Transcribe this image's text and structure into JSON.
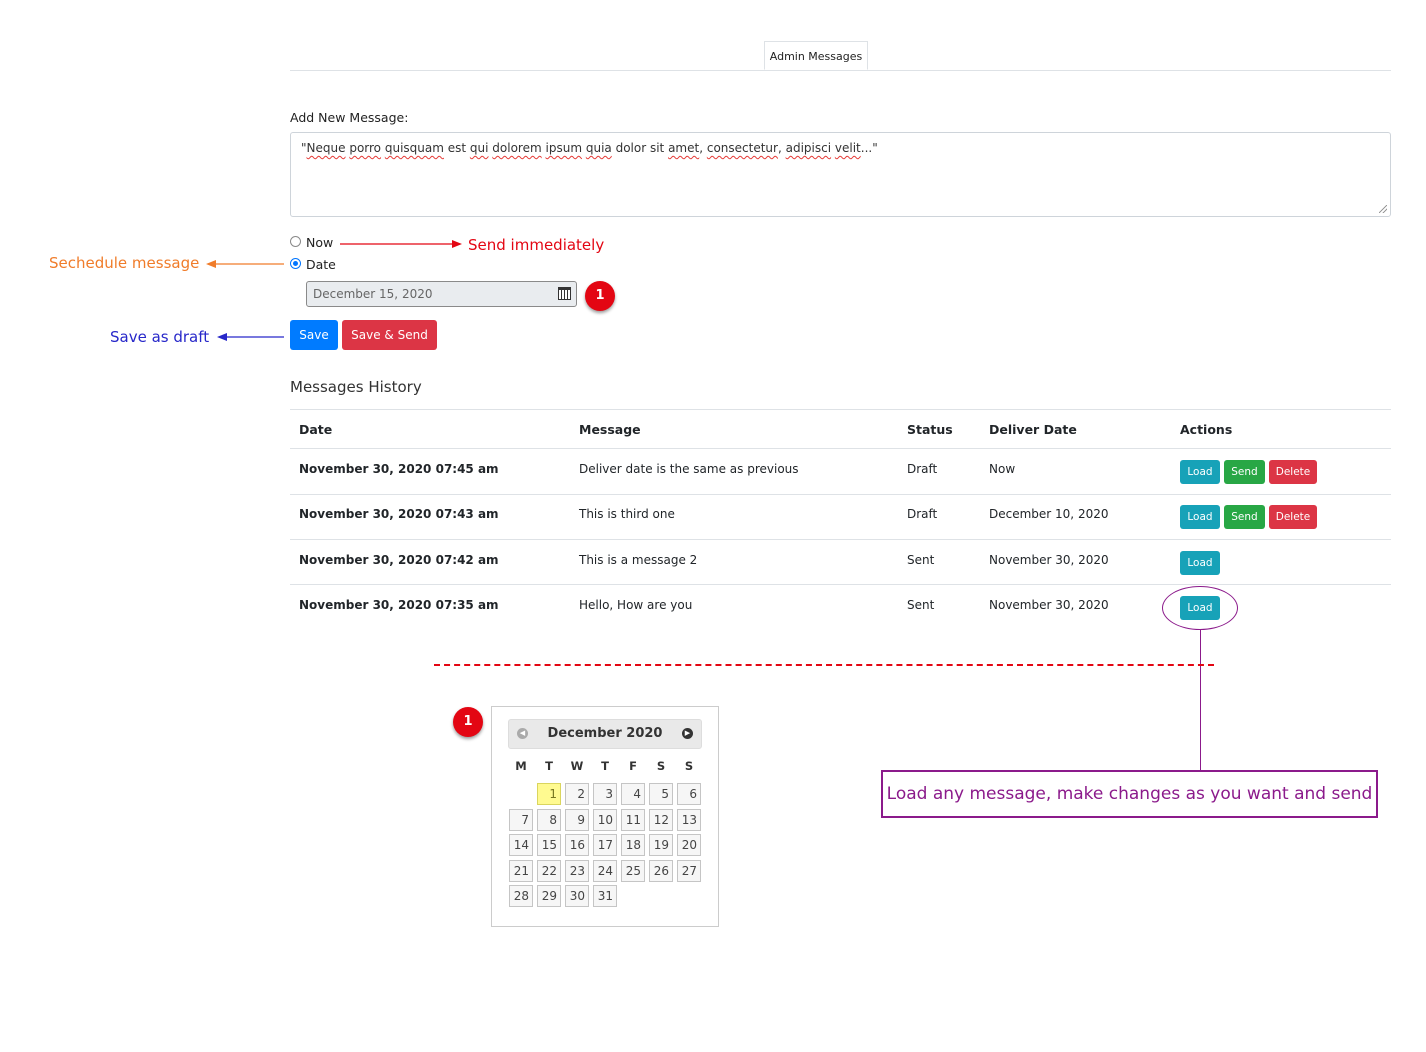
{
  "tabs": [
    {
      "label": "Admin Messages"
    }
  ],
  "form": {
    "add_label": "Add New Message:",
    "message_parts": [
      {
        "text": "\"",
        "sq": false
      },
      {
        "text": "Neque",
        "sq": true
      },
      {
        "text": " ",
        "sq": false
      },
      {
        "text": "porro",
        "sq": true
      },
      {
        "text": " ",
        "sq": false
      },
      {
        "text": "quisquam",
        "sq": true
      },
      {
        "text": " est ",
        "sq": false
      },
      {
        "text": "qui",
        "sq": true
      },
      {
        "text": " ",
        "sq": false
      },
      {
        "text": "dolorem",
        "sq": true
      },
      {
        "text": " ",
        "sq": false
      },
      {
        "text": "ipsum",
        "sq": true
      },
      {
        "text": " ",
        "sq": false
      },
      {
        "text": "quia",
        "sq": true
      },
      {
        "text": " dolor sit ",
        "sq": false
      },
      {
        "text": "amet",
        "sq": true
      },
      {
        "text": ", ",
        "sq": false
      },
      {
        "text": "consectetur",
        "sq": true
      },
      {
        "text": ", ",
        "sq": false
      },
      {
        "text": "adipisci",
        "sq": true
      },
      {
        "text": " ",
        "sq": false
      },
      {
        "text": "velit",
        "sq": true
      },
      {
        "text": "...\"",
        "sq": false
      }
    ],
    "radio_now": "Now",
    "radio_date": "Date",
    "selected": "date",
    "date_value": "December 15, 2020",
    "save_label": "Save",
    "save_send_label": "Save & Send"
  },
  "history": {
    "title": "Messages History",
    "columns": [
      "Date",
      "Message",
      "Status",
      "Deliver Date",
      "Actions"
    ],
    "rows": [
      {
        "date": "November 30, 2020 07:45 am",
        "message": "Deliver date is the same as previous",
        "status": "Draft",
        "deliver": "Now",
        "actions": [
          "Load",
          "Send",
          "Delete"
        ]
      },
      {
        "date": "November 30, 2020 07:43 am",
        "message": "This is third one",
        "status": "Draft",
        "deliver": "December 10, 2020",
        "actions": [
          "Load",
          "Send",
          "Delete"
        ]
      },
      {
        "date": "November 30, 2020 07:42 am",
        "message": "This is a message 2",
        "status": "Sent",
        "deliver": "November 30, 2020",
        "actions": [
          "Load"
        ]
      },
      {
        "date": "November 30, 2020 07:35 am",
        "message": "Hello, How are you",
        "status": "Sent",
        "deliver": "November 30, 2020",
        "actions": [
          "Load"
        ]
      }
    ]
  },
  "annotations": {
    "schedule": "Sechedule message",
    "send_immediately": "Send immediately",
    "save_draft": "Save as draft",
    "load_note": "Load any message, make changes as you want and send",
    "badge": "1",
    "colors": {
      "orange": "#f07c2a",
      "red": "#e30613",
      "blue": "#2727c9",
      "purple": "#8b1a8b"
    }
  },
  "calendar": {
    "title": "December 2020",
    "weekdays": [
      "M",
      "T",
      "W",
      "T",
      "F",
      "S",
      "S"
    ],
    "first_weekday_index": 1,
    "days_in_month": 31,
    "today": 1
  }
}
